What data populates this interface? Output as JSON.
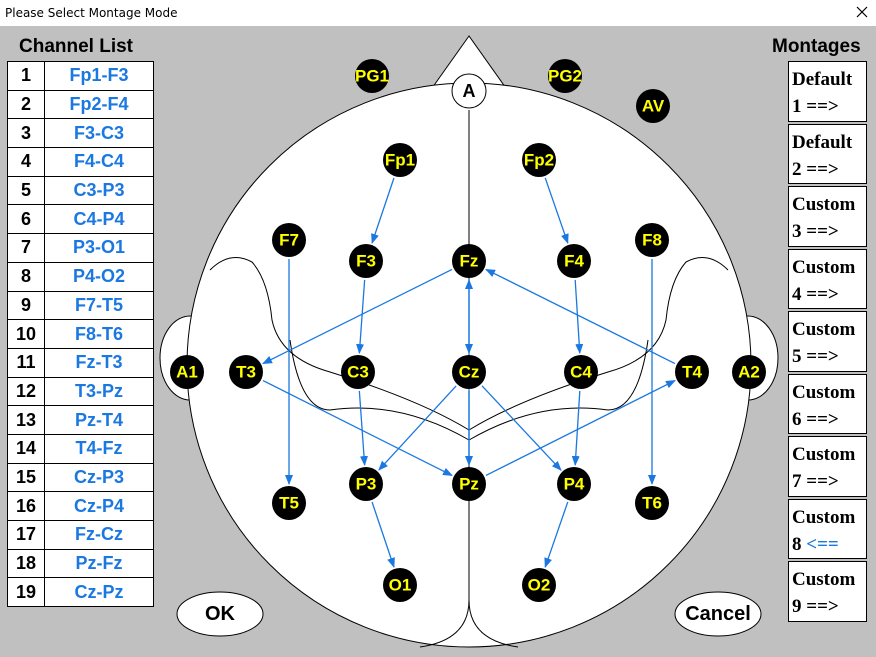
{
  "window": {
    "title": "Please Select Montage Mode"
  },
  "channel_list": {
    "title": "Channel List",
    "rows": [
      {
        "num": "1",
        "pair": "Fp1-F3"
      },
      {
        "num": "2",
        "pair": "Fp2-F4"
      },
      {
        "num": "3",
        "pair": "F3-C3"
      },
      {
        "num": "4",
        "pair": "F4-C4"
      },
      {
        "num": "5",
        "pair": "C3-P3"
      },
      {
        "num": "6",
        "pair": "C4-P4"
      },
      {
        "num": "7",
        "pair": "P3-O1"
      },
      {
        "num": "8",
        "pair": "P4-O2"
      },
      {
        "num": "9",
        "pair": "F7-T5"
      },
      {
        "num": "10",
        "pair": "F8-T6"
      },
      {
        "num": "11",
        "pair": "Fz-T3"
      },
      {
        "num": "12",
        "pair": "T3-Pz"
      },
      {
        "num": "13",
        "pair": "Pz-T4"
      },
      {
        "num": "14",
        "pair": "T4-Fz"
      },
      {
        "num": "15",
        "pair": "Cz-P3"
      },
      {
        "num": "16",
        "pair": "Cz-P4"
      },
      {
        "num": "17",
        "pair": "Fz-Cz"
      },
      {
        "num": "18",
        "pair": "Pz-Fz"
      },
      {
        "num": "19",
        "pair": "Cz-Pz"
      }
    ]
  },
  "montages": {
    "title": "Montages",
    "items": [
      {
        "label": "Default",
        "num": "1",
        "arrow": "==>",
        "selected": false
      },
      {
        "label": "Default",
        "num": "2",
        "arrow": "==>",
        "selected": false
      },
      {
        "label": "Custom",
        "num": "3",
        "arrow": "==>",
        "selected": false
      },
      {
        "label": "Custom",
        "num": "4",
        "arrow": "==>",
        "selected": false
      },
      {
        "label": "Custom",
        "num": "5",
        "arrow": "==>",
        "selected": false
      },
      {
        "label": "Custom",
        "num": "6",
        "arrow": "==>",
        "selected": false
      },
      {
        "label": "Custom",
        "num": "7",
        "arrow": "==>",
        "selected": false
      },
      {
        "label": "Custom",
        "num": "8",
        "arrow": "<==",
        "selected": true
      },
      {
        "label": "Custom",
        "num": "9",
        "arrow": "==>",
        "selected": false
      }
    ]
  },
  "head": {
    "nose_label": "A",
    "electrodes": [
      "PG1",
      "PG2",
      "AV",
      "Fp1",
      "Fp2",
      "F7",
      "F3",
      "Fz",
      "F4",
      "F8",
      "A1",
      "T3",
      "C3",
      "Cz",
      "C4",
      "T4",
      "A2",
      "P3",
      "Pz",
      "P4",
      "T5",
      "T6",
      "O1",
      "O2"
    ]
  },
  "buttons": {
    "ok": "OK",
    "cancel": "Cancel"
  },
  "colors": {
    "arrow": "#1a78e0",
    "electrode_fill": "#000000",
    "electrode_text": "#ffff00",
    "background": "#c0c0c0"
  }
}
